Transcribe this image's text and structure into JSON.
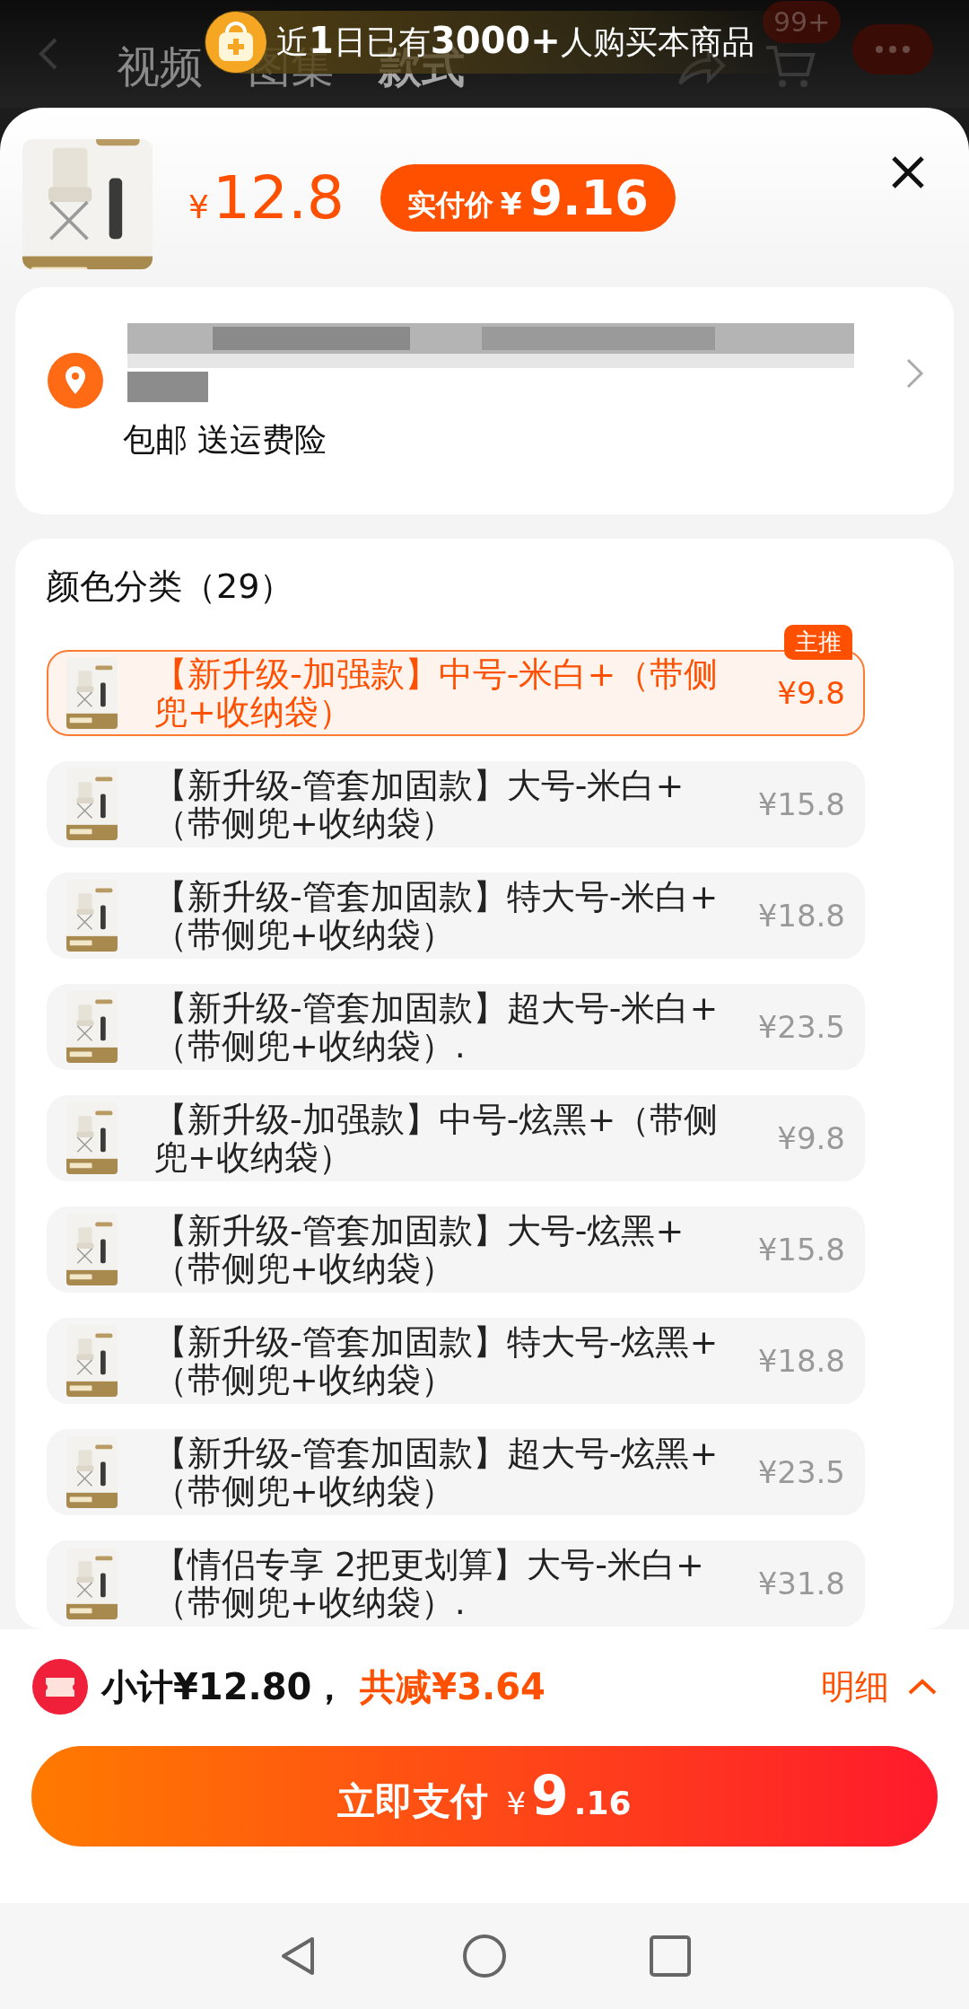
{
  "top_nav": {
    "tabs": [
      {
        "label": "视频",
        "selected": false
      },
      {
        "label": "图集",
        "selected": false
      },
      {
        "label": "款式",
        "selected": true
      }
    ],
    "cart_badge": "99+"
  },
  "banner": {
    "text": "近**1**日已有**3000+**人购买本商品"
  },
  "product": {
    "price_currency": "¥",
    "price": "12.8",
    "actual_price_label": "实付价",
    "actual_price_currency": "¥",
    "actual_price": "9.16"
  },
  "address": {
    "shipping": "包邮 送运费险"
  },
  "variants": {
    "title": "颜色分类（29）",
    "items": [
      {
        "label": "【新升级-加强款】中号-米白+（带侧兜+收纳袋）",
        "price": "¥9.8",
        "selected": true,
        "badge": "主推"
      },
      {
        "label": "【新升级-管套加固款】大号-米白+（带侧兜+收纳袋）",
        "price": "¥15.8",
        "selected": false
      },
      {
        "label": "【新升级-管套加固款】特大号-米白+（带侧兜+收纳袋）",
        "price": "¥18.8",
        "selected": false
      },
      {
        "label": "【新升级-管套加固款】超大号-米白+（带侧兜+收纳袋）.",
        "price": "¥23.5",
        "selected": false
      },
      {
        "label": "【新升级-加强款】中号-炫黑+（带侧兜+收纳袋）",
        "price": "¥9.8",
        "selected": false
      },
      {
        "label": "【新升级-管套加固款】大号-炫黑+（带侧兜+收纳袋）",
        "price": "¥15.8",
        "selected": false
      },
      {
        "label": "【新升级-管套加固款】特大号-炫黑+（带侧兜+收纳袋）",
        "price": "¥18.8",
        "selected": false
      },
      {
        "label": "【新升级-管套加固款】超大号-炫黑+（带侧兜+收纳袋）",
        "price": "¥23.5",
        "selected": false
      },
      {
        "label": "【情侣专享 2把更划算】大号-米白+（带侧兜+收纳袋）.",
        "price": "¥31.8",
        "selected": false
      }
    ]
  },
  "footer": {
    "subtotal": "小计¥12.80，",
    "discount": "共减¥3.64",
    "details": "明细",
    "pay_label": "立即支付",
    "pay_currency": "¥",
    "pay_integer": "9",
    "pay_decimal": ".16"
  }
}
